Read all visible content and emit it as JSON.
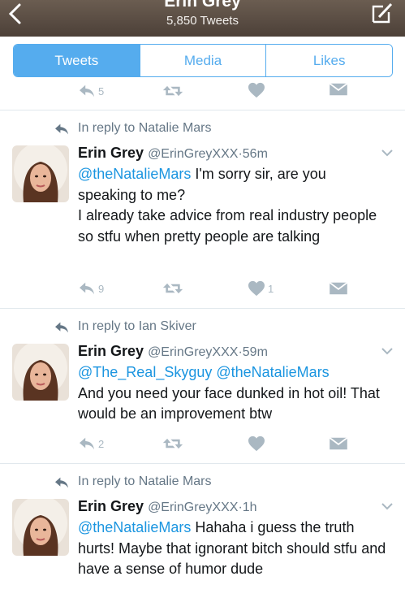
{
  "header": {
    "title": "Erin Grey",
    "subtitle": "5,850 Tweets"
  },
  "tabs": [
    {
      "label": "Tweets",
      "active": true
    },
    {
      "label": "Media",
      "active": false
    },
    {
      "label": "Likes",
      "active": false
    }
  ],
  "top_actions": {
    "reply_count": "5"
  },
  "tweets": [
    {
      "context": "In reply to Natalie Mars",
      "name": "Erin Grey",
      "handle": "@ErinGreyXXX",
      "sep": "·",
      "time": "56m",
      "mention": "@theNatalieMars",
      "text_after_mention": " I'm sorry sir, are you speaking to me?",
      "text_line2": "I already take advice from real industry people so stfu when pretty people are talking",
      "reply_count": "9",
      "retweet_count": "",
      "like_count": "1"
    },
    {
      "context": "In reply to Ian Skiver",
      "name": "Erin Grey",
      "handle": "@ErinGreyXXX",
      "sep": "·",
      "time": "59m",
      "mention": "@The_Real_Skyguy @theNatalieMars",
      "text_after_mention": "",
      "text_line2": "And you need your face dunked in hot oil! That would be an improvement btw",
      "reply_count": "2",
      "retweet_count": "",
      "like_count": ""
    },
    {
      "context": "In reply to Natalie Mars",
      "name": "Erin Grey",
      "handle": "@ErinGreyXXX",
      "sep": "·",
      "time": "1h",
      "mention": "@theNatalieMars",
      "text_after_mention": " Hahaha i guess the truth hurts! Maybe that ignorant bitch should stfu and have a sense of humor dude",
      "text_line2": "",
      "reply_count": "",
      "retweet_count": "",
      "like_count": ""
    }
  ],
  "icons": {
    "back": "chevron-left-icon",
    "compose": "compose-icon",
    "reply": "reply-icon",
    "retweet": "retweet-icon",
    "like": "heart-icon",
    "dm": "envelope-icon",
    "caret": "chevron-down-icon"
  },
  "colors": {
    "accent": "#55acee",
    "mention": "#1b95e0",
    "muted": "#657786",
    "action": "#aab8c2"
  }
}
